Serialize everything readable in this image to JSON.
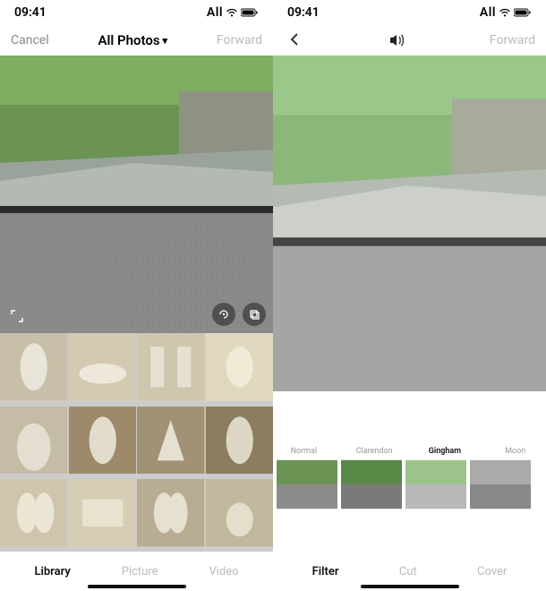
{
  "left": {
    "status": {
      "time": "09:41",
      "carrier": "All"
    },
    "nav": {
      "cancel": "Cancel",
      "title": "All Photos",
      "forward": "Forward"
    },
    "tabs": {
      "library": "Library",
      "picture": "Picture",
      "video": "Video"
    }
  },
  "right": {
    "status": {
      "time": "09:41",
      "carrier": "All"
    },
    "nav": {
      "forward": "Forward"
    },
    "filters": {
      "normal": "Normal",
      "clarendon": "Clarendon",
      "gingham": "Gingham",
      "moon": "Moon"
    },
    "tabs": {
      "filter": "Filter",
      "cut": "Cut",
      "cover": "Cover"
    }
  }
}
